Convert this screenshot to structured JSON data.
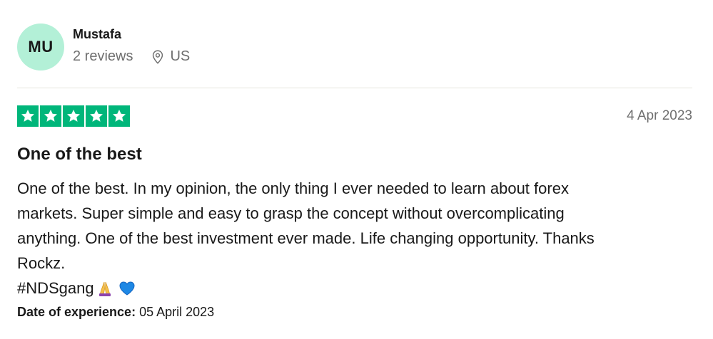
{
  "reviewer": {
    "initials": "MU",
    "name": "Mustafa",
    "reviews_count": "2 reviews",
    "country": "US"
  },
  "review": {
    "rating": 5,
    "date": "4 Apr 2023",
    "title": "One of the best",
    "body_lines": [
      "One of the best. In my opinion, the only thing I ever needed to learn about forex",
      "markets. Super simple and easy to grasp the concept without overcomplicating",
      "anything. One of the best investment ever made. Life changing opportunity. Thanks",
      "Rockz."
    ],
    "hashtag": "#NDSgang",
    "experience_label": "Date of experience:",
    "experience_date": "05 April 2023"
  },
  "colors": {
    "star_green": "#00b67a",
    "avatar_bg": "#b3f0d7",
    "heart_blue": "#1e88e5"
  },
  "icons": {
    "location": "location-pin-icon",
    "star": "star-icon",
    "emoji_1": "praying-hands-icon",
    "emoji_2": "blue-heart-icon"
  }
}
